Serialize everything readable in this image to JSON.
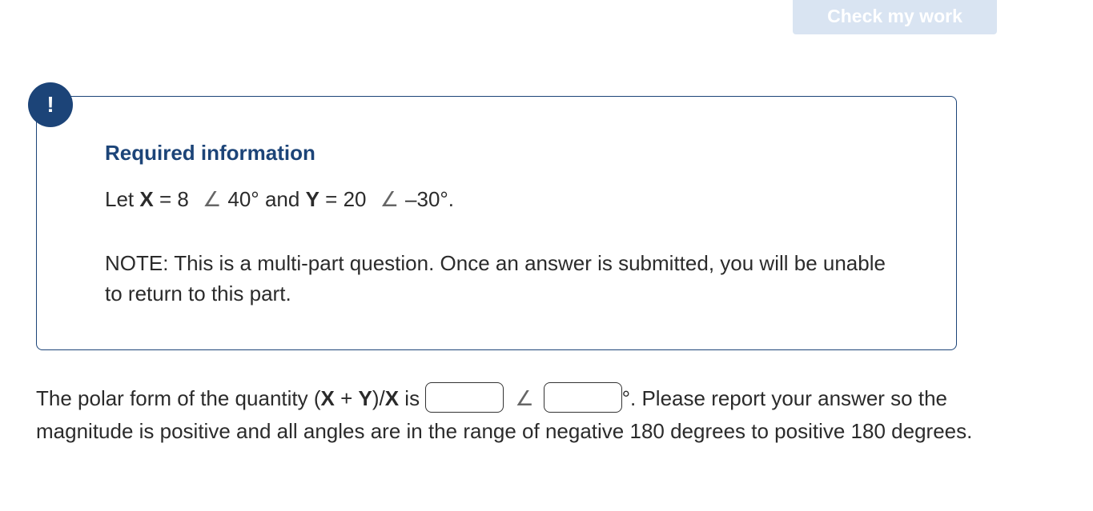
{
  "toolbar": {
    "check_label": "Check my work"
  },
  "alert": {
    "badge": "!"
  },
  "required_info": {
    "title": "Required information",
    "let": "Let",
    "x_var": "X",
    "x_mag": "= 8",
    "x_angle": "40°",
    "and": "and",
    "y_var": "Y",
    "y_mag": "= 20",
    "y_angle": "–30°.",
    "angle_symbol": "∠",
    "note": "NOTE: This is a multi-part question. Once an answer is submitted, you will be unable to return to this part."
  },
  "question": {
    "prefix": "The polar form of the quantity (",
    "x_var": "X",
    "plus": " + ",
    "y_var": "Y",
    "mid": ")/",
    "x_var2": "X",
    "is": " is ",
    "angle_symbol": "∠",
    "suffix": "°. Please report your answer so the magnitude is positive and all angles are in the range of negative 180 degrees to positive 180 degrees.",
    "magnitude_value": "",
    "angle_value": ""
  }
}
